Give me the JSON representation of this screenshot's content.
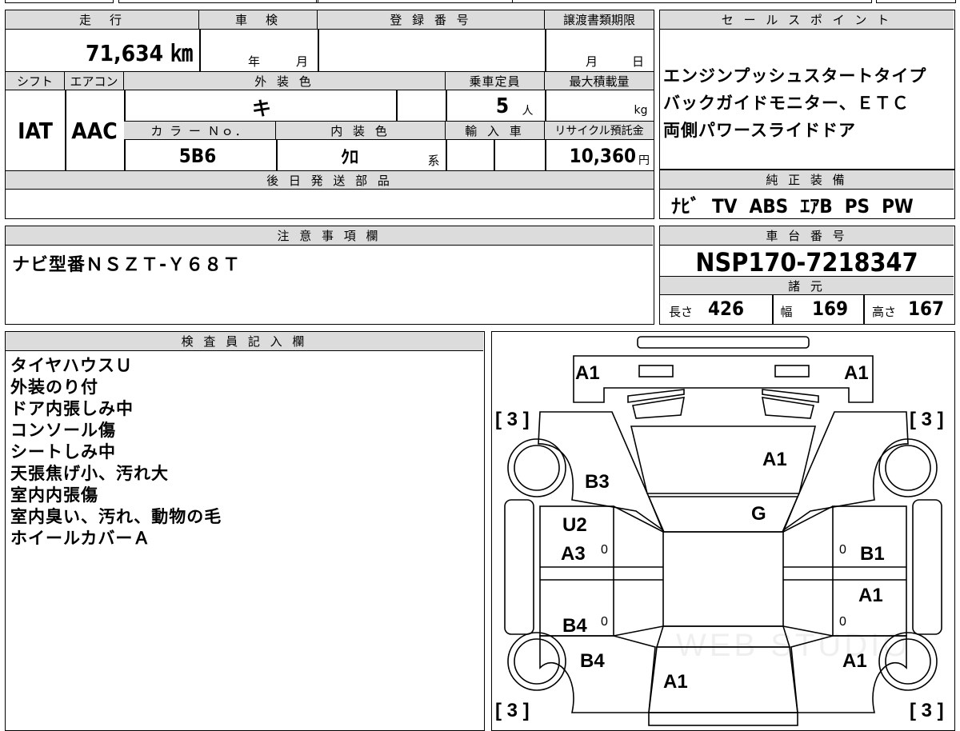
{
  "top": {
    "mileage_label": "走　行",
    "mileage": "71,634 ㎞",
    "inspection_label": "車　検",
    "inspection_year": "年",
    "inspection_month": "月",
    "registration_label": "登 録 番 号",
    "transfer_label": "譲渡書類期限",
    "transfer_month": "月",
    "transfer_day": "日",
    "shift_label": "シフト",
    "aircon_label": "エアコン",
    "exterior_color_label": "外 装 色",
    "exterior_color": "キ",
    "capacity_label": "乗車定員",
    "capacity": "5",
    "capacity_unit": "人",
    "max_load_label": "最大積載量",
    "max_load_unit": "kg",
    "shift": "IAT",
    "aircon": "AAC",
    "color_no_label": "カ ラ ー Ｎｏ．",
    "color_no": "5B6",
    "interior_color_label": "内 装 色",
    "interior_color": "ｸﾛ",
    "interior_color_suffix": "系",
    "import_label": "輸 入 車",
    "recycle_label": "リサイクル預託金",
    "recycle_fee": "10,360",
    "recycle_unit": "円",
    "later_parts_label": "後 日 発 送 部 品"
  },
  "sales_points": {
    "label": "セ ー ル ス ポ イ ン ト",
    "lines": [
      "エンジンプッシュスタートタイプ",
      "バックガイドモニター、ＥＴＣ",
      "両側パワースライドドア"
    ]
  },
  "equipment": {
    "label": "純 正 装 備",
    "items": "ﾅﾋﾞ  TV  ABS  ｴｱB  PS  PW"
  },
  "notes": {
    "label": "注 意 事 項 欄",
    "text": "ナビ型番ＮＳＺＴ-Ｙ６８Ｔ"
  },
  "chassis": {
    "label": "車 台 番 号",
    "number": "NSP170-7218347",
    "spec_label": "諸 元",
    "length_label": "長さ",
    "length": "426",
    "width_label": "幅",
    "width": "169",
    "height_label": "高さ",
    "height": "167"
  },
  "inspector": {
    "label": "検 査 員 記 入 欄",
    "lines": [
      "タイヤハウスＵ",
      "外装のり付",
      "ドア内張しみ中",
      "コンソール傷",
      "シートしみ中",
      "天張焦げ小、汚れ大",
      "室内内張傷",
      "室内臭い、汚れ、動物の毛",
      "ホイールカバーＡ"
    ]
  },
  "diagram": {
    "watermark": "WEB STUDIO",
    "marks": {
      "front_left": "A1",
      "front_right": "A1",
      "hood": "A1",
      "windshield": "G",
      "left_front_fender": "B3",
      "left_front_door_1": "U2",
      "left_front_door_2": "A3",
      "right_front_door": "B1",
      "right_rear_door": "A1",
      "left_rear_door": "B4",
      "left_rear_fender": "B4",
      "right_rear_fender": "A1",
      "rear": "A1",
      "zero_a": "0",
      "zero_b": "0",
      "zero_c": "0",
      "zero_d": "0"
    },
    "tires": {
      "fl": "[ 3 ]",
      "fr": "[ 3 ]",
      "rl": "[ 3 ]",
      "rr": "[ 3 ]"
    }
  }
}
